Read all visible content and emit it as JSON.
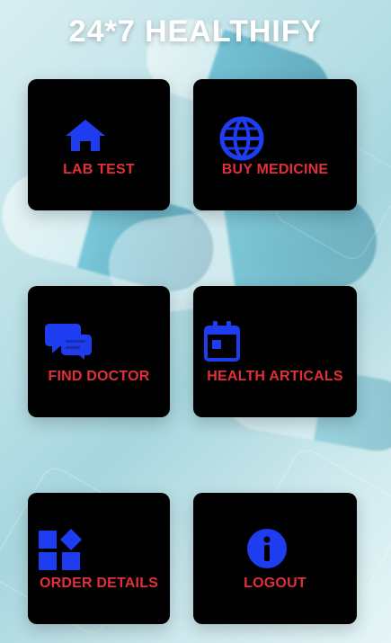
{
  "app": {
    "title": "24*7 HEALTHIFY"
  },
  "theme": {
    "tile_bg": "#000000",
    "label_color": "#e1303a",
    "icon_color": "#1f3df0"
  },
  "menu": {
    "items": [
      {
        "label": "LAB TEST",
        "icon": "home-icon"
      },
      {
        "label": "BUY MEDICINE",
        "icon": "globe-icon"
      },
      {
        "label": "FIND DOCTOR",
        "icon": "chat-icon"
      },
      {
        "label": "HEALTH ARTICALS",
        "icon": "calendar-icon"
      },
      {
        "label": "ORDER DETAILS",
        "icon": "widgets-icon"
      },
      {
        "label": "LOGOUT",
        "icon": "info-icon"
      }
    ]
  }
}
